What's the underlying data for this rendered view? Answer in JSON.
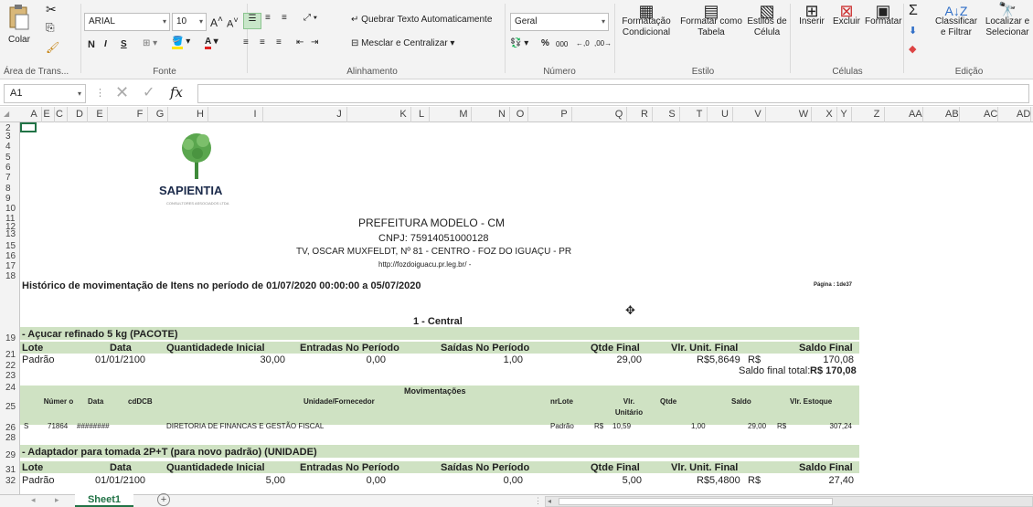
{
  "ribbon": {
    "clipboard": {
      "paste": "Colar",
      "group": "Área de Trans..."
    },
    "font": {
      "name": "ARIAL",
      "size": "10",
      "bold": "N",
      "italic": "I",
      "underline": "S",
      "group": "Fonte"
    },
    "alignment": {
      "wrap": "Quebrar Texto Automaticamente",
      "merge": "Mesclar e Centralizar",
      "group": "Alinhamento"
    },
    "number": {
      "format": "Geral",
      "percent": "%",
      "thousands": "000",
      "group": "Número"
    },
    "styles": {
      "conditional": "Formatação\nCondicional",
      "table": "Formatar como\nTabela",
      "cell": "Estilos de\nCélula",
      "group": "Estilo"
    },
    "cells": {
      "insert": "Inserir",
      "delete": "Excluir",
      "format": "Formatar",
      "group": "Células"
    },
    "editing": {
      "sort": "Classificar\ne Filtrar",
      "find": "Localizar e\nSelecionar",
      "group": "Edição"
    }
  },
  "formula_bar": {
    "name_box": "A1",
    "fx": "fx",
    "value": ""
  },
  "columns": [
    "A",
    "E",
    "C",
    "D",
    "E",
    "F",
    "G",
    "H",
    "I",
    "J",
    "K",
    "L",
    "M",
    "N",
    "O",
    "P",
    "Q",
    "R",
    "S",
    "T",
    "U",
    "V",
    "W",
    "X",
    "Y",
    "Z",
    "AA",
    "AB",
    "AC",
    "AD"
  ],
  "rows": [
    "2",
    "3",
    "4",
    "5",
    "6",
    "7",
    "8",
    "9",
    "10",
    "11",
    "12",
    "13",
    "15",
    "16",
    "17",
    "18",
    "19",
    "21",
    "22",
    "23",
    "24",
    "25",
    "26",
    "28",
    "29",
    "31",
    "32"
  ],
  "sheet": {
    "logo_text": "SAPIENTIA",
    "logo_sub": "CONSULTORES ASSOCIADOS LTDA",
    "org": "PREFEITURA MODELO - CM",
    "cnpj": "CNPJ: 75914051000128",
    "address": "TV, OSCAR MUXFELDT, Nº 81 - CENTRO - FOZ DO IGUAÇU - PR",
    "url": "http://fozdoiguacu.pr.leg.br/ -",
    "report_title": "Histórico de movimentação de Itens no período de 01/07/2020 00:00:00 a 05/07/2020",
    "page": "Página : 1de37",
    "unit": "1 - Central",
    "item1": {
      "name": "- Açucar refinado 5 kg (PACOTE)",
      "lote": "Padrão",
      "data": "01/01/2100",
      "qi": "30,00",
      "ent": "0,00",
      "sai": "1,00",
      "qf": "29,00",
      "vu": "R$5,8649",
      "cur": "R$",
      "saldo": "170,08",
      "total_label": "Saldo final total:",
      "total": "R$ 170,08"
    },
    "headers": {
      "lote": "Lote",
      "data": "Data",
      "qi": "Quantidadede Inicial",
      "ent": "Entradas No Período",
      "sai": "Saídas No Período",
      "qf": "Qtde Final",
      "vu": "Vlr. Unit. Final",
      "saldo": "Saldo Final"
    },
    "mov": {
      "title": "Movimentações",
      "numero": "Númer o",
      "data": "Data",
      "cd": "cdDCB",
      "unid": "Unidade/Fornecedor",
      "lote": "nrLote",
      "vlr": "Vlr. Unitário",
      "qtde": "Qtde",
      "saldo": "Saldo",
      "estoque": "Vlr. Estoque"
    },
    "mov_row": {
      "tipo": "S",
      "num": "71864",
      "data": "########",
      "unid": "DIRETORIA DE FINANCAS E GESTÃO FISCAL",
      "lote": "Padrão",
      "cur": "R$",
      "vlr": "10,59",
      "qtde": "1,00",
      "saldo": "29,00",
      "cur2": "R$",
      "estoque": "307,24"
    },
    "item2": {
      "name": "- Adaptador para tomada 2P+T (para novo padrão) (UNIDADE)",
      "lote": "Padrão",
      "data": "01/01/2100",
      "qi": "5,00",
      "ent": "0,00",
      "sai": "0,00",
      "qf": "5,00",
      "vu": "R$5,4800",
      "cur": "R$",
      "saldo": "27,40"
    }
  },
  "tabs": {
    "sheet1": "Sheet1",
    "add": "+"
  }
}
